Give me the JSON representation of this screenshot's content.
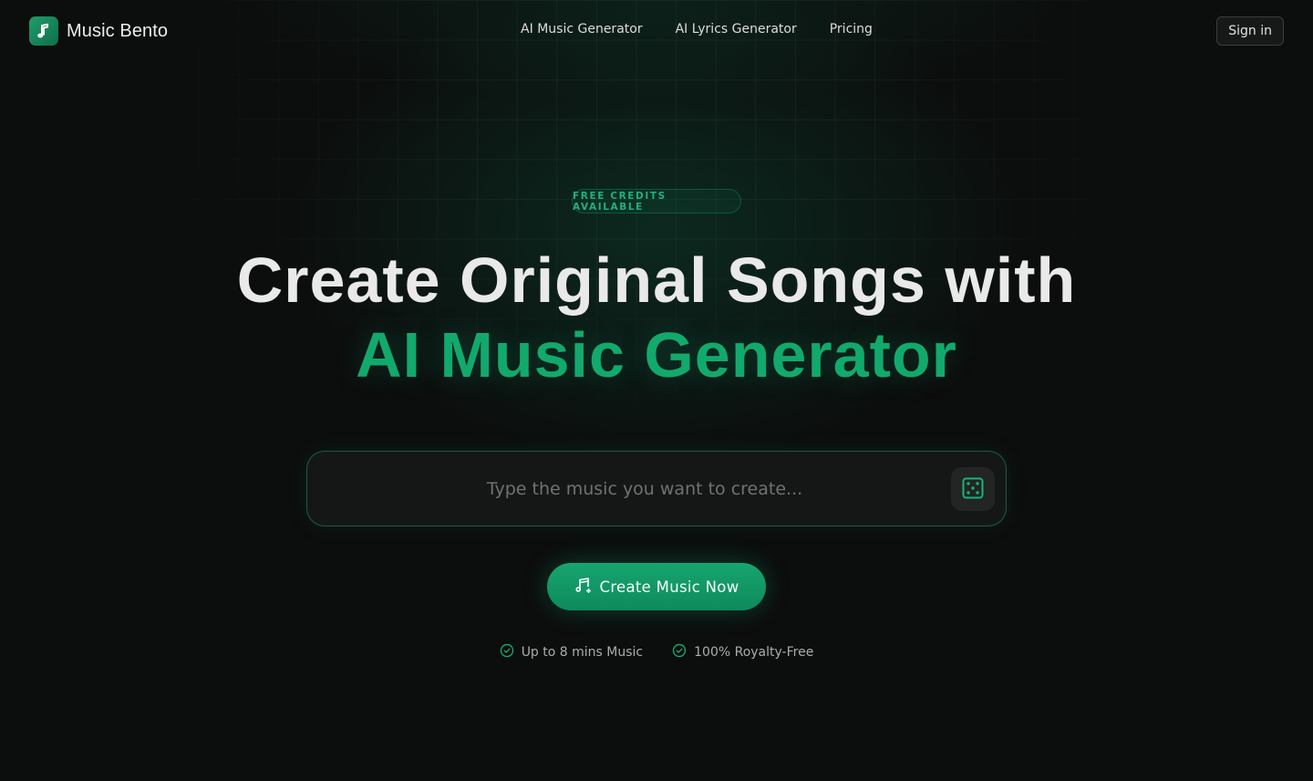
{
  "header": {
    "brand_name": "Music Bento",
    "nav": [
      "AI Music Generator",
      "AI Lyrics Generator",
      "Pricing"
    ],
    "signin_label": "Sign in"
  },
  "hero": {
    "badge": "FREE CREDITS AVAILABLE",
    "title_line1": "Create Original Songs with",
    "title_line2": "AI Music Generator",
    "accent_color": "#12a96d"
  },
  "prompt": {
    "placeholder": "Type the music you want to create...",
    "value": "",
    "random_icon": "dice-icon"
  },
  "cta": {
    "label": "Create Music Now",
    "icon": "music-note-plus-icon"
  },
  "features": [
    {
      "label": "Up to 8 mins Music",
      "icon": "check-circle-icon"
    },
    {
      "label": "100% Royalty-Free",
      "icon": "check-circle-icon"
    }
  ]
}
